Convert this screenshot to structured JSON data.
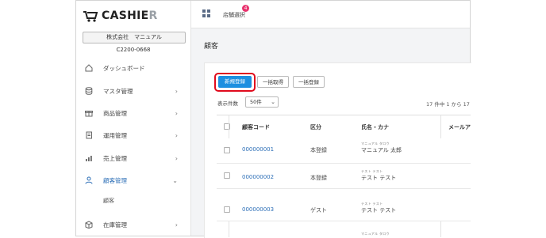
{
  "app": {
    "logo_text_main": "CASHIE",
    "logo_text_tail": "R",
    "company_name": "株式会社　マニュアル",
    "company_code": "C2200-0668"
  },
  "sidebar": {
    "items": [
      {
        "label": "ダッシュボード",
        "icon": "home-icon"
      },
      {
        "label": "マスタ管理",
        "icon": "database-icon"
      },
      {
        "label": "商品管理",
        "icon": "gift-icon"
      },
      {
        "label": "運用管理",
        "icon": "document-icon"
      },
      {
        "label": "売上管理",
        "icon": "bar-chart-icon"
      },
      {
        "label": "顧客管理",
        "icon": "user-icon"
      },
      {
        "label": "在庫管理",
        "icon": "box-icon"
      }
    ],
    "sub_items": [
      {
        "label": "顧客"
      }
    ]
  },
  "topbar": {
    "store_select_label": "店舗選択",
    "notification_count": "4"
  },
  "main": {
    "page_title": "顧客",
    "buttons": {
      "new": "新規登録",
      "bulk_get": "一括取得",
      "bulk_register": "一括登録"
    },
    "per_page_label": "表示件数",
    "per_page_value": "50件",
    "count_text": "17 件中 1 から 17"
  },
  "table": {
    "headers": [
      "顧客コード",
      "区分",
      "氏名・カナ",
      "メールア"
    ],
    "rows": [
      {
        "code": "000000001",
        "category": "本登録",
        "kana": "マニュアル タロウ",
        "name": "マニュアル 太郎"
      },
      {
        "code": "000000002",
        "category": "本登録",
        "kana": "テスト テスト",
        "name": "テスト テスト"
      },
      {
        "code": "000000003",
        "category": "ゲスト",
        "kana": "テスト テスト",
        "name": "テスト テスト"
      }
    ],
    "partial_row_kana": "マニュアル タロウ"
  },
  "colors": {
    "primary": "#1c8fe0",
    "link": "#2d6fb7",
    "highlight": "#e00b1d",
    "badge": "#e8336e"
  }
}
